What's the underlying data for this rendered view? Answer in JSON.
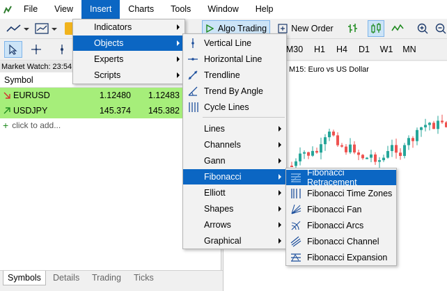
{
  "menubar": {
    "items": [
      {
        "label": "File"
      },
      {
        "label": "View"
      },
      {
        "label": "Insert"
      },
      {
        "label": "Charts"
      },
      {
        "label": "Tools"
      },
      {
        "label": "Window"
      },
      {
        "label": "Help"
      }
    ]
  },
  "toolbar": {
    "algo_trading": "Algo Trading",
    "new_order": "New Order",
    "timeframes": [
      "M30",
      "H1",
      "H4",
      "D1",
      "W1",
      "MN"
    ]
  },
  "market_watch": {
    "title": "Market Watch: 23:54",
    "column_symbol": "Symbol",
    "rows": [
      {
        "symbol": "EURUSD",
        "bid": "1.12480",
        "ask": "1.12483"
      },
      {
        "symbol": "USDJPY",
        "bid": "145.374",
        "ask": "145.382"
      }
    ],
    "add_label": "click to add...",
    "tabs": [
      "Symbols",
      "Details",
      "Trading",
      "Ticks"
    ]
  },
  "chart": {
    "title": "M15:  Euro vs US Dollar"
  },
  "insert_menu": {
    "items": [
      "Indicators",
      "Objects",
      "Experts",
      "Scripts"
    ]
  },
  "objects_menu": {
    "items": [
      "Vertical Line",
      "Horizontal Line",
      "Trendline",
      "Trend By Angle",
      "Cycle Lines",
      "Lines",
      "Channels",
      "Gann",
      "Fibonacci",
      "Elliott",
      "Shapes",
      "Arrows",
      "Graphical"
    ]
  },
  "fibonacci_menu": {
    "items": [
      "Fibonacci Retracement",
      "Fibonacci Time Zones",
      "Fibonacci Fan",
      "Fibonacci Arcs",
      "Fibonacci Channel",
      "Fibonacci Expansion"
    ]
  },
  "colors": {
    "highlight": "#0b66c3",
    "quote_row": "#a6ee7a",
    "bull_candle": "#26a69a",
    "bear_candle": "#ef5350"
  }
}
